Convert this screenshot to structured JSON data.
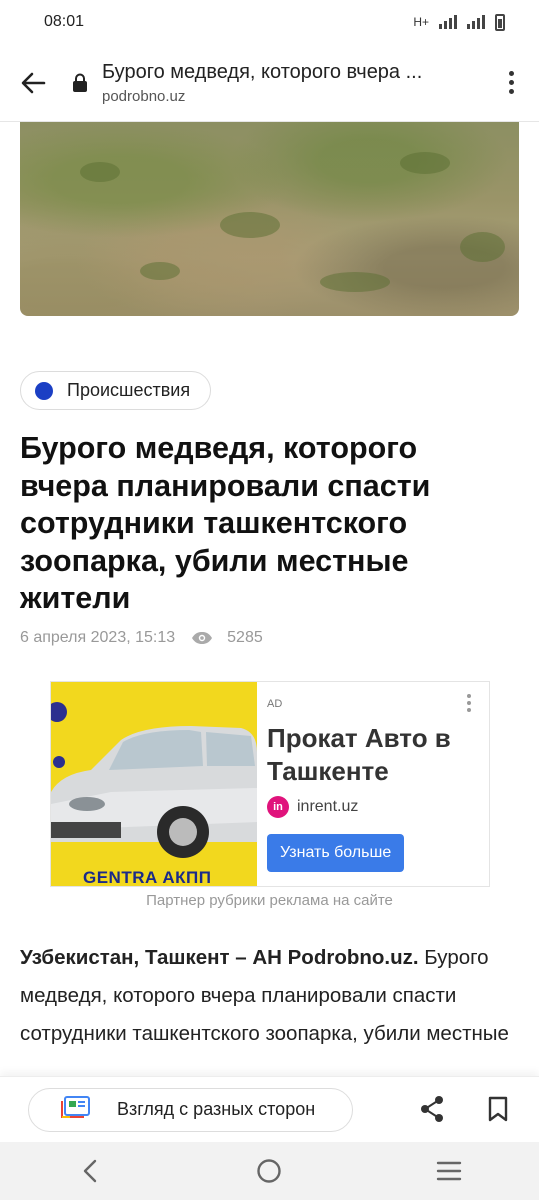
{
  "status_bar": {
    "time": "08:01",
    "network": "H+"
  },
  "browser": {
    "page_title": "Бурого медведя, которого вчера ...",
    "domain": "podrobno.uz"
  },
  "article": {
    "category": "Происшествия",
    "category_color": "#1b3fc4",
    "headline": "Бурого медведя, которого вчера планировали спасти сотрудники ташкентского зоопарка, убили местные жители",
    "date": "6 апреля 2023, 15:13",
    "views": "5285",
    "lead_bold": "Узбекистан, Ташкент – АН Podrobno.uz.",
    "body": "Бурого медведя, которого вчера планировали спасти сотрудники ташкентского зоопарка, убили местные"
  },
  "ad": {
    "tag": "AD",
    "title": "Прокат Авто в Ташкенте",
    "advertiser": "inrent.uz",
    "logo_text": "in",
    "cta": "Узнать больше",
    "image_caption": "GENTRA АКПП",
    "note": "Партнер рубрики реклама на сайте"
  },
  "bottom_bar": {
    "perspectives_label": "Взгляд с разных сторон"
  },
  "colors": {
    "accent": "#3a7be8",
    "ad_bg": "#f2d81e"
  }
}
